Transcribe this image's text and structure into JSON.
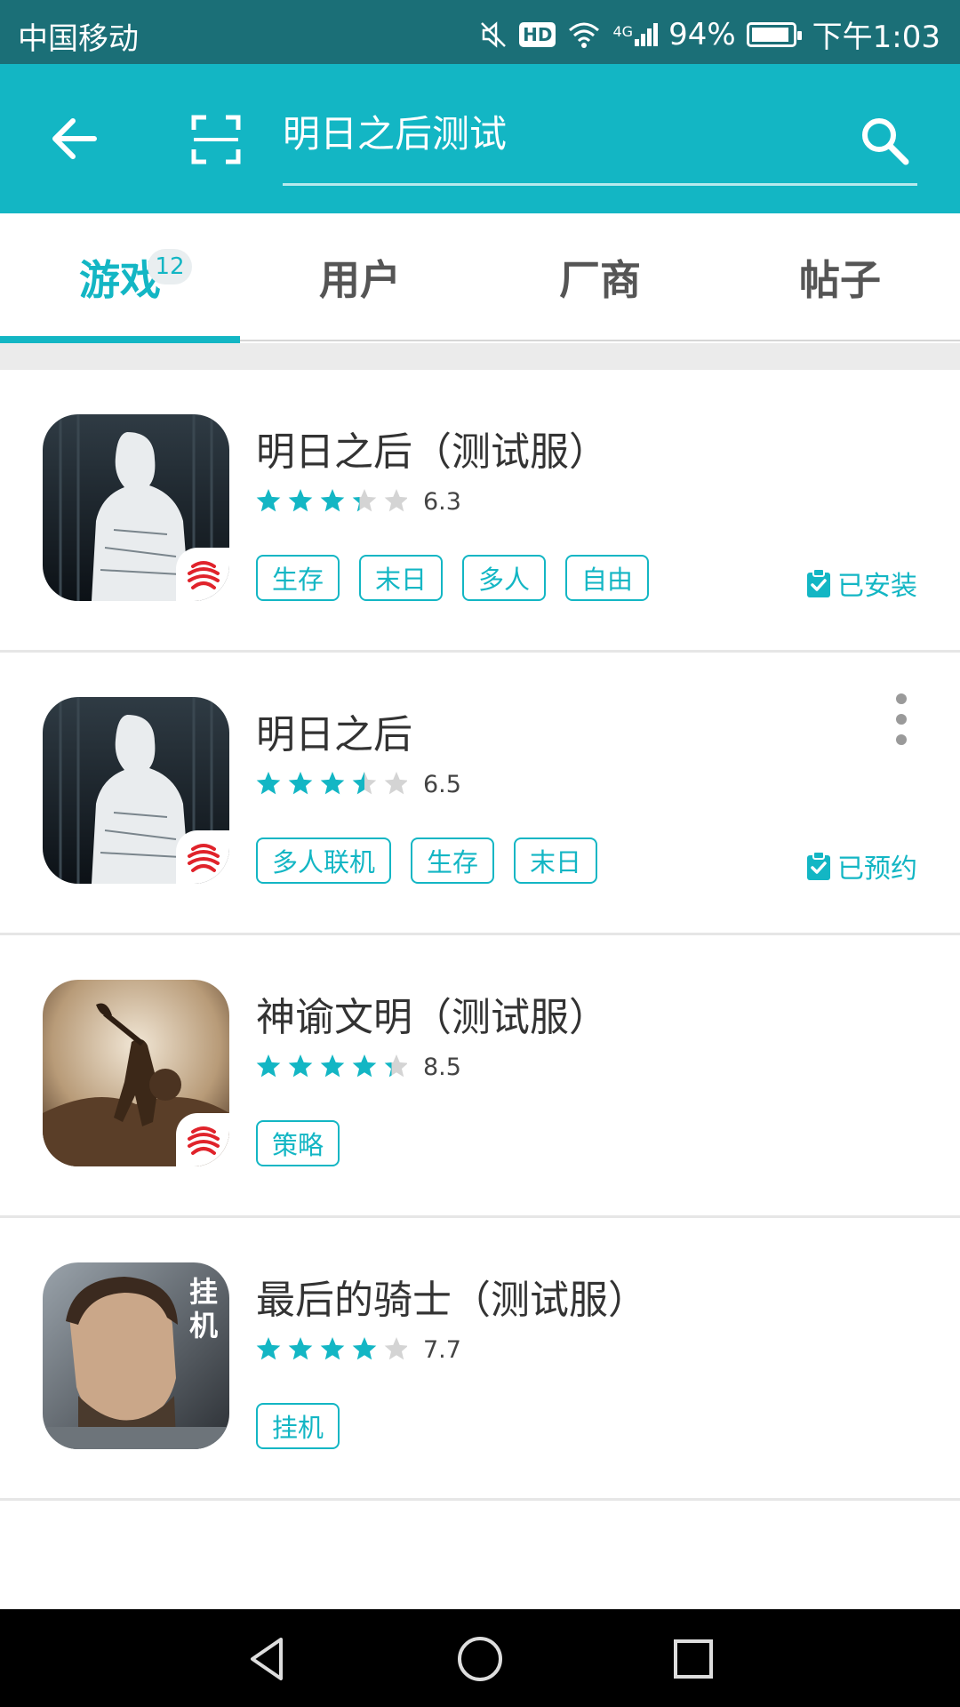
{
  "status_bar": {
    "carrier": "中国移动",
    "network_label": "4G",
    "hd_label": "HD",
    "battery": "94%",
    "battery_fraction": 0.94,
    "time": "下午1:03"
  },
  "search": {
    "query": "明日之后测试"
  },
  "tabs": [
    {
      "label": "游戏",
      "badge": "12",
      "active": true
    },
    {
      "label": "用户",
      "active": false
    },
    {
      "label": "厂商",
      "active": false
    },
    {
      "label": "帖子",
      "active": false
    }
  ],
  "games": [
    {
      "title": "明日之后（测试服）",
      "rating": 6.3,
      "score": "6.3",
      "stars": 3.3,
      "tags": [
        "生存",
        "末日",
        "多人",
        "自由"
      ],
      "status": "已安装",
      "publisher_badge": true,
      "icon": "silhouette-forest-icon"
    },
    {
      "title": "明日之后",
      "rating": 6.5,
      "score": "6.5",
      "stars": 3.5,
      "tags": [
        "多人联机",
        "生存",
        "末日"
      ],
      "status": "已预约",
      "publisher_badge": true,
      "has_more": true,
      "icon": "silhouette-forest-icon"
    },
    {
      "title": "神谕文明（测试服）",
      "rating": 8.5,
      "score": "8.5",
      "stars": 4.3,
      "tags": [
        "策略"
      ],
      "publisher_badge": true,
      "icon": "warrior-battle-icon"
    },
    {
      "title": "最后的骑士（测试服）",
      "rating": 7.7,
      "score": "7.7",
      "stars": 4.0,
      "tags": [
        "挂机"
      ],
      "publisher_badge": false,
      "icon": "knight-portrait-icon",
      "icon_text": "挂机"
    }
  ],
  "colors": {
    "accent": "#13b6c4",
    "status_bar": "#1b6f77",
    "star_empty": "#d4d4d4"
  }
}
